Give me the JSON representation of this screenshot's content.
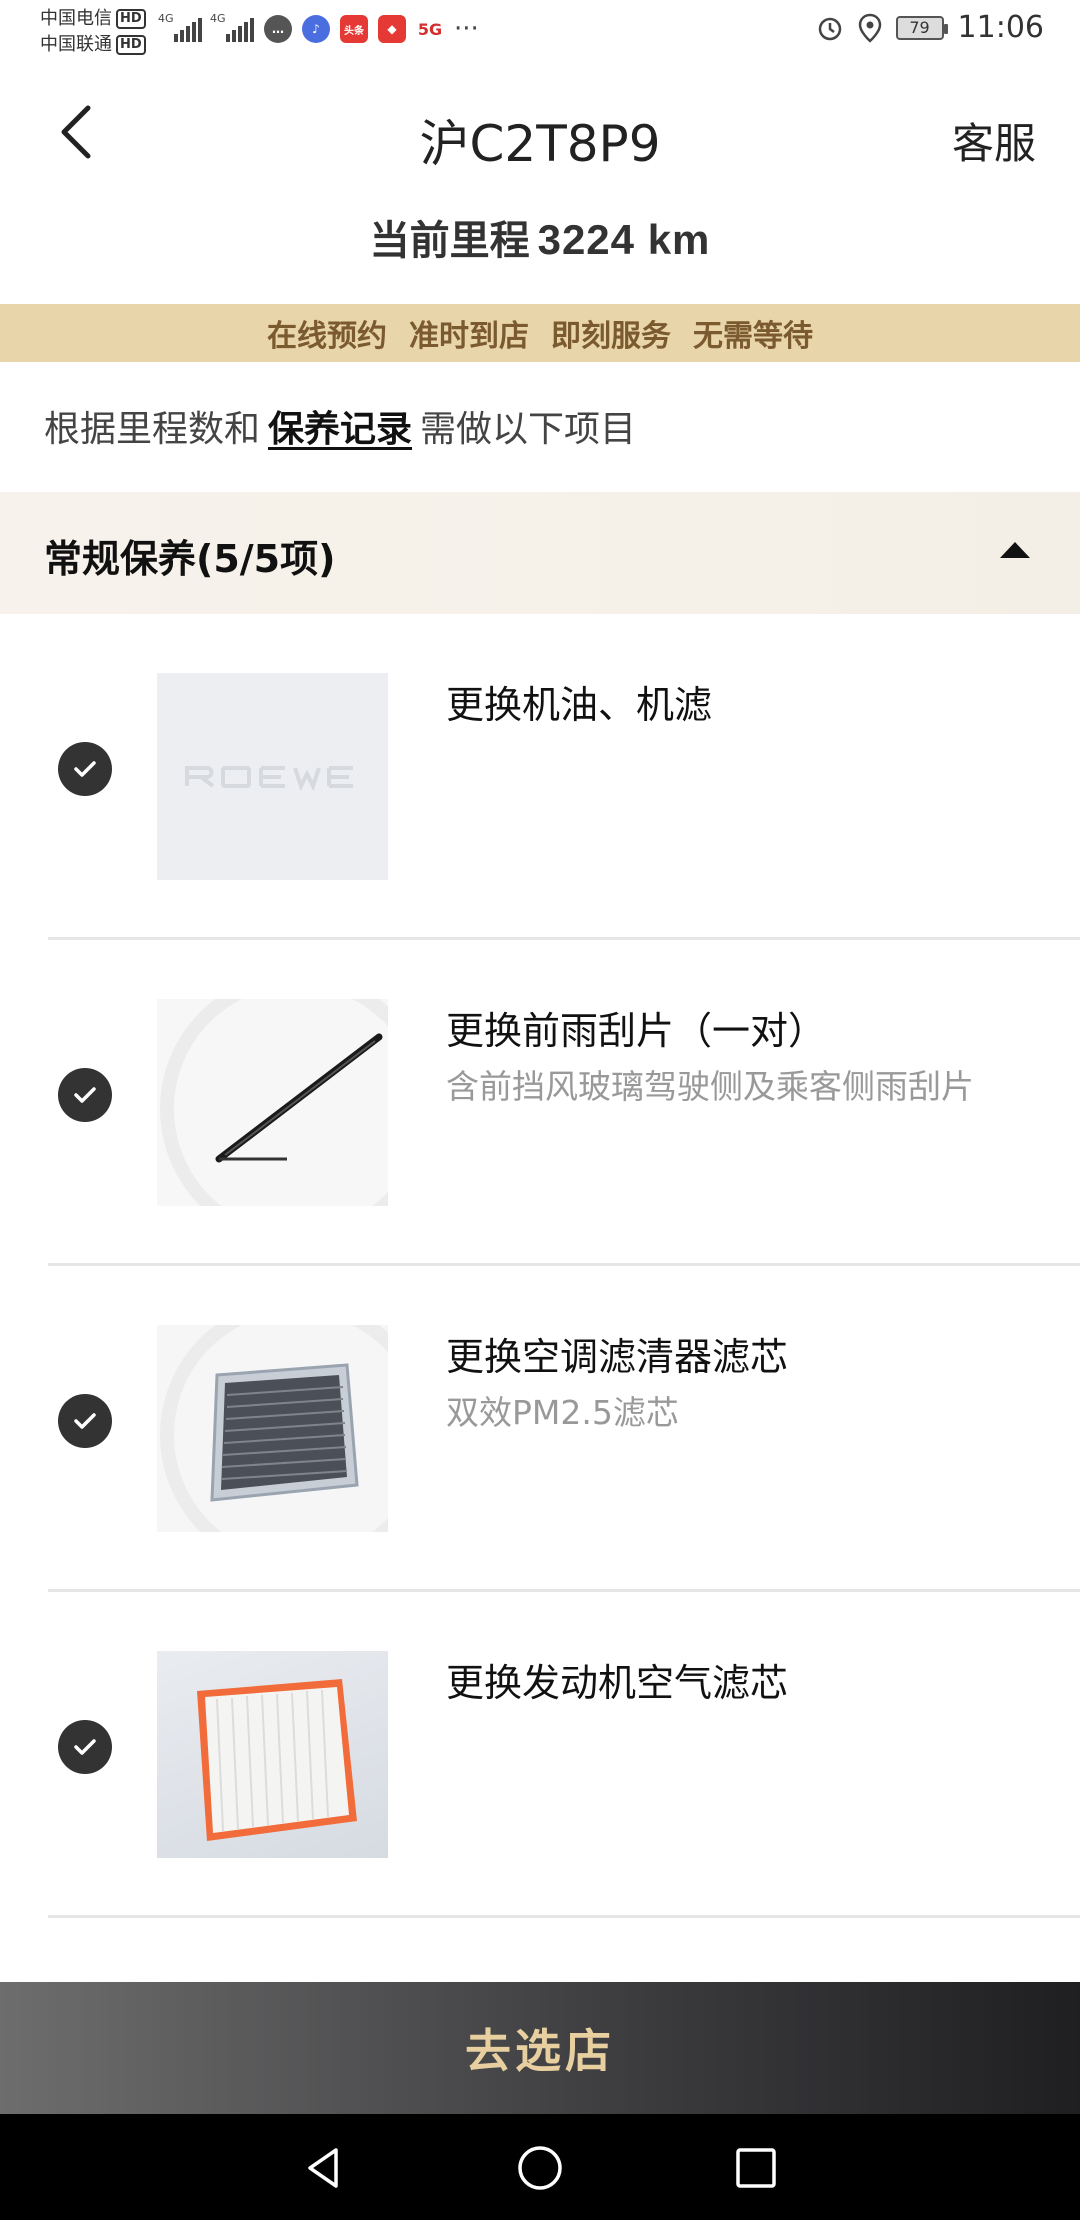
{
  "status_bar": {
    "carrier1": "中国电信",
    "carrier2": "中国联通",
    "hd": "HD",
    "sig1_label": "4G",
    "sig2_label": "4G",
    "app_toutiao": "头条",
    "app_5g": "5G",
    "more": "···",
    "battery": "79",
    "time": "11:06"
  },
  "header": {
    "title": "沪C2T8P9",
    "service": "客服"
  },
  "mileage": {
    "label": "当前里程",
    "value": "3224 km"
  },
  "banner": [
    "在线预约",
    "准时到店",
    "即刻服务",
    "无需等待"
  ],
  "hint": {
    "prefix": "根据里程数和",
    "link": "保养记录",
    "suffix": "需做以下项目"
  },
  "section": {
    "title": "常规保养(5/5项)"
  },
  "items": [
    {
      "name": "更换机油、机滤",
      "desc": "",
      "image": "roewe-placeholder",
      "checked": true
    },
    {
      "name": "更换前雨刮片（一对）",
      "desc": "含前挡风玻璃驾驶侧及乘客侧雨刮片",
      "image": "wiper-blade",
      "checked": true
    },
    {
      "name": "更换空调滤清器滤芯",
      "desc": "双效PM2.5滤芯",
      "image": "cabin-filter",
      "checked": true
    },
    {
      "name": "更换发动机空气滤芯",
      "desc": "",
      "image": "engine-air-filter",
      "checked": true
    }
  ],
  "cta": {
    "label": "去选店"
  },
  "colors": {
    "banner_bg": "#e8d5a9",
    "banner_text": "#7a5a2e",
    "cta_text": "#e8cfa0",
    "check_bg": "#333333"
  }
}
